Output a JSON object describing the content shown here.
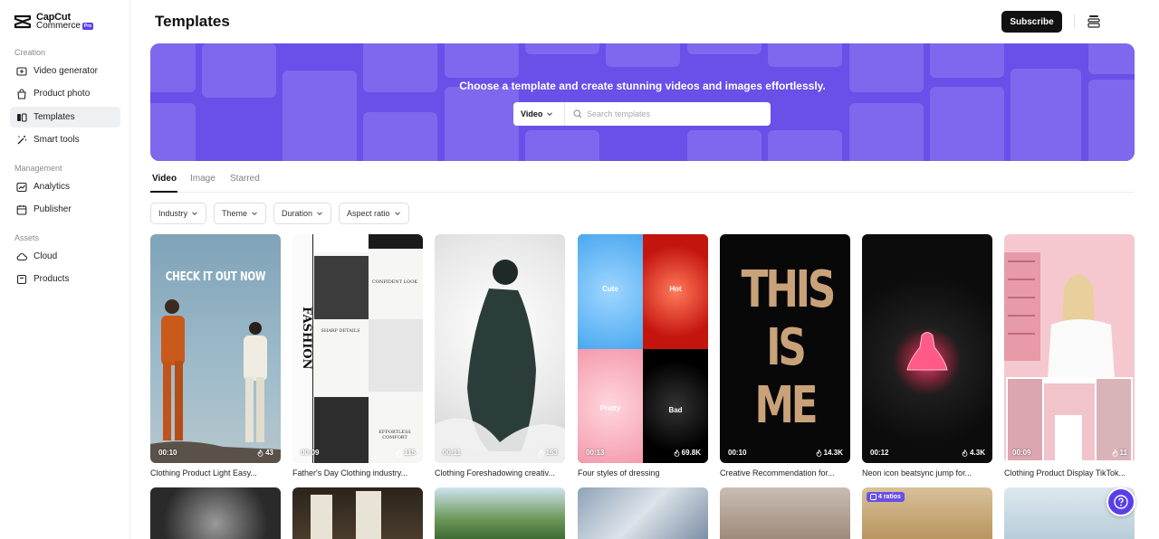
{
  "brand": {
    "line1": "CapCut",
    "line2": "Commerce",
    "badge": "Pro"
  },
  "sidebar": {
    "sections": [
      {
        "title": "Creation",
        "items": [
          {
            "label": "Video generator",
            "icon": "video-plus-icon"
          },
          {
            "label": "Product photo",
            "icon": "bag-icon"
          },
          {
            "label": "Templates",
            "icon": "templates-icon",
            "active": true
          },
          {
            "label": "Smart tools",
            "icon": "magic-wand-icon"
          }
        ]
      },
      {
        "title": "Management",
        "items": [
          {
            "label": "Analytics",
            "icon": "chart-icon"
          },
          {
            "label": "Publisher",
            "icon": "calendar-icon"
          }
        ]
      },
      {
        "title": "Assets",
        "items": [
          {
            "label": "Cloud",
            "icon": "cloud-icon"
          },
          {
            "label": "Products",
            "icon": "box-icon"
          }
        ]
      }
    ]
  },
  "header": {
    "title": "Templates",
    "subscribe_label": "Subscribe"
  },
  "banner": {
    "heading": "Choose a template and create stunning videos and images effortlessly.",
    "search_type": "Video",
    "search_placeholder": "Search templates",
    "color": "#6a4fe8"
  },
  "tabs": [
    {
      "label": "Video",
      "active": true
    },
    {
      "label": "Image"
    },
    {
      "label": "Starred"
    }
  ],
  "filters": [
    "Industry",
    "Theme",
    "Duration",
    "Aspect ratio"
  ],
  "templates": [
    {
      "title": "Clothing Product Light Easy...",
      "duration": "00:10",
      "likes": "43",
      "overlay_text": "CHECK IT OUT NOW"
    },
    {
      "title": "Father's Day Clothing industry...",
      "duration": "00:09",
      "likes": "115",
      "overlay_text": "FASHION",
      "captions": [
        "CONFIDENT LOOK",
        "SHARP DETAILS",
        "EFFORTLESS COMFORT"
      ]
    },
    {
      "title": "Clothing Foreshadowing creativ...",
      "duration": "00:11",
      "likes": "163"
    },
    {
      "title": "Four styles of dressing",
      "duration": "00:13",
      "likes": "69.8K",
      "quadrant_labels": [
        "Cute",
        "Hot",
        "Pretty",
        "Bad"
      ]
    },
    {
      "title": "Creative Recommendation for...",
      "duration": "00:10",
      "likes": "14.3K",
      "overlay_text": "THIS IS ME"
    },
    {
      "title": "Neon icon beatsync jump for...",
      "duration": "00:12",
      "likes": "4.3K"
    },
    {
      "title": "Clothing Product Display TikTok...",
      "duration": "00:09",
      "likes": "11"
    }
  ],
  "row2_badge": "4 ratios"
}
